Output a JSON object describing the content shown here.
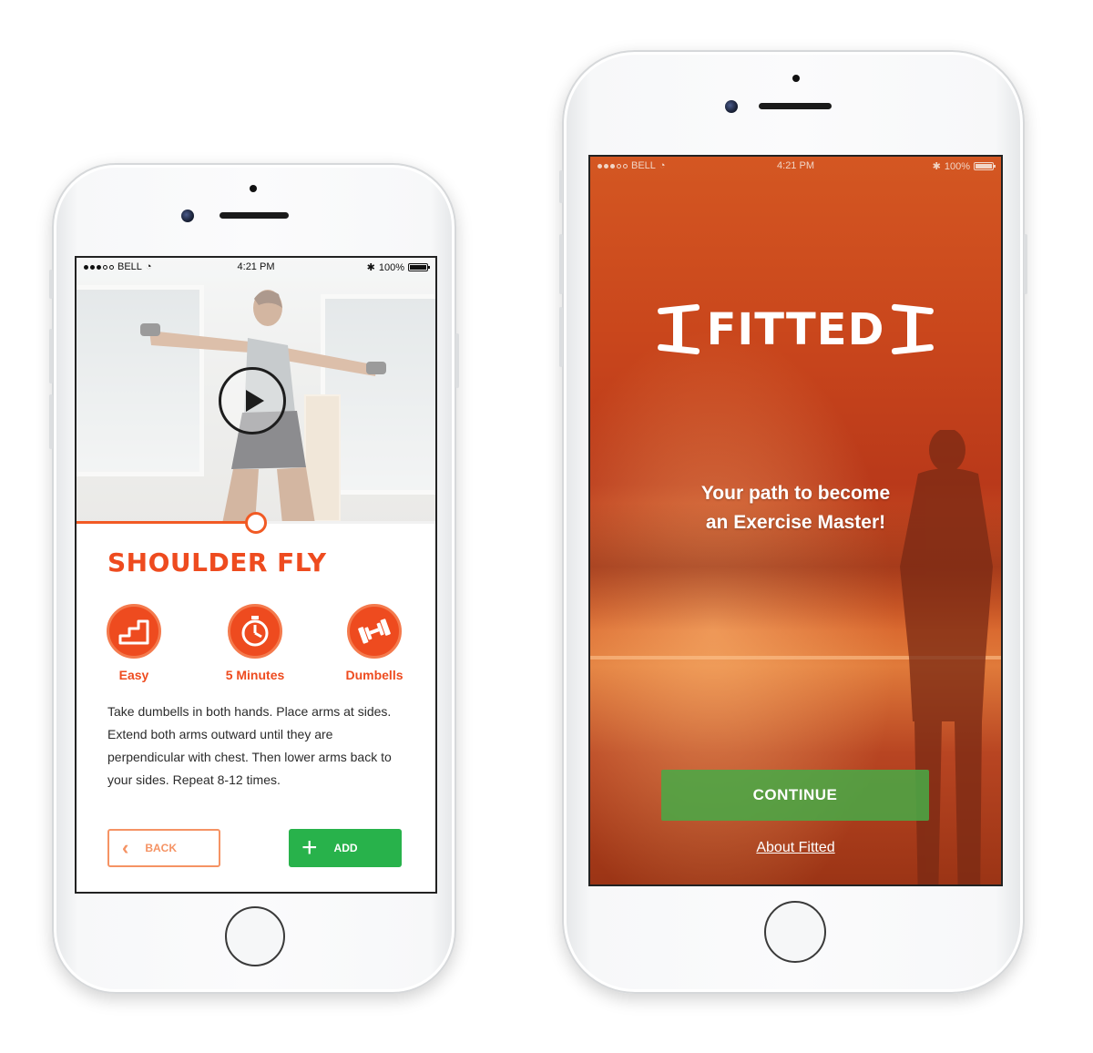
{
  "colors": {
    "accent": "#ee4b1f",
    "add_green": "#28b24b",
    "continue_green": "#48aa46",
    "back_border": "#f59364"
  },
  "left_phone": {
    "status": {
      "carrier": "BELL",
      "time": "4:21 PM",
      "battery": "100%"
    },
    "video": {
      "progress": 0.5,
      "play_icon": "play-icon"
    },
    "exercise": {
      "title": "SHOULDER FLY",
      "stats": [
        {
          "icon": "stairs-icon",
          "label": "Easy"
        },
        {
          "icon": "stopwatch-icon",
          "label": "5 Minutes"
        },
        {
          "icon": "dumbbell-icon",
          "label": "Dumbells"
        }
      ],
      "description": "Take dumbells in both hands. Place arms at sides. Extend both arms outward until they are perpendicular with chest. Then lower arms back to your sides. Repeat 8-12 times."
    },
    "buttons": {
      "back": "BACK",
      "add": "ADD"
    }
  },
  "right_phone": {
    "status": {
      "carrier": "BELL",
      "time": "4:21 PM",
      "battery": "100%"
    },
    "logo": "FITTED",
    "tagline_line1": "Your path to become",
    "tagline_line2": "an Exercise Master!",
    "continue": "CONTINUE",
    "about": "About Fitted"
  }
}
